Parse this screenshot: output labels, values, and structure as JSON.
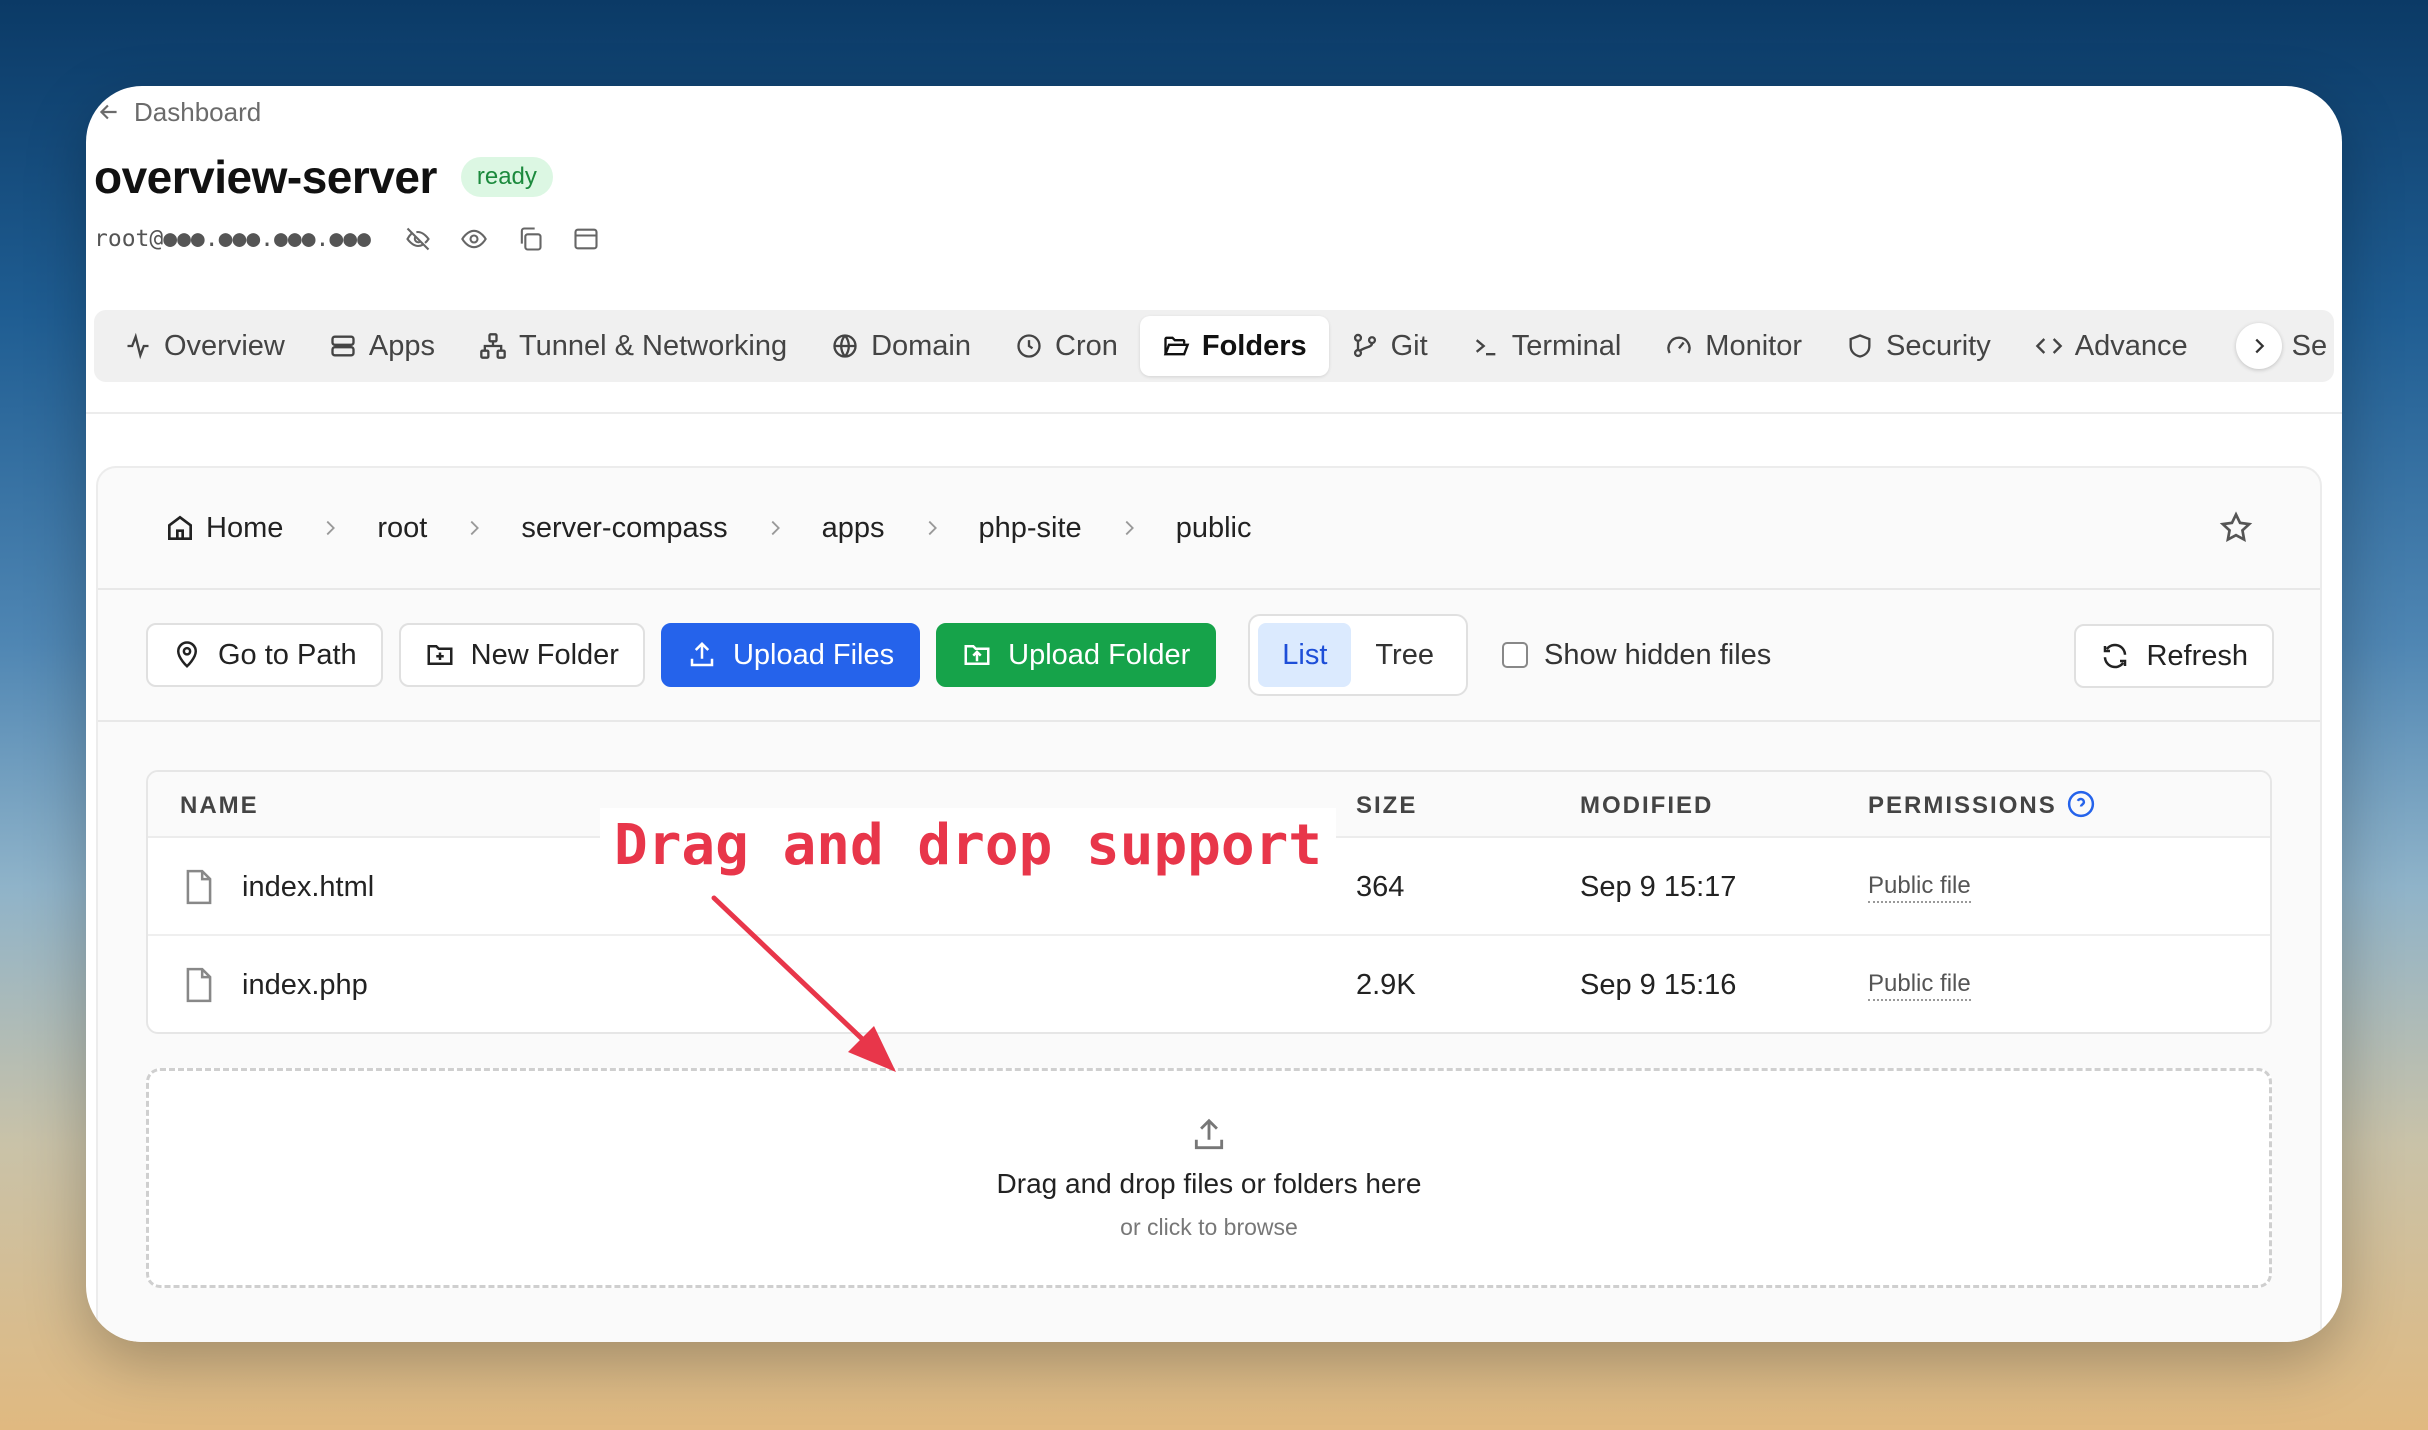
{
  "breadcrumb_back": "Dashboard",
  "server": {
    "name": "overview-server",
    "status": "ready",
    "host": "root@●●●.●●●.●●●.●●●"
  },
  "tabs": [
    {
      "label": "Overview",
      "icon": "activity-icon"
    },
    {
      "label": "Apps",
      "icon": "server-icon"
    },
    {
      "label": "Tunnel & Networking",
      "icon": "network-icon"
    },
    {
      "label": "Domain",
      "icon": "globe-icon"
    },
    {
      "label": "Cron",
      "icon": "clock-icon"
    },
    {
      "label": "Folders",
      "icon": "folder-open-icon",
      "active": true
    },
    {
      "label": "Git",
      "icon": "git-branch-icon"
    },
    {
      "label": "Terminal",
      "icon": "terminal-icon"
    },
    {
      "label": "Monitor",
      "icon": "gauge-icon"
    },
    {
      "label": "Security",
      "icon": "shield-icon"
    },
    {
      "label": "Advance",
      "icon": "code-icon"
    }
  ],
  "tab_overflow_text": "Se",
  "path": [
    "Home",
    "root",
    "server-compass",
    "apps",
    "php-site",
    "public"
  ],
  "toolbar": {
    "go_to_path": "Go to Path",
    "new_folder": "New Folder",
    "upload_files": "Upload Files",
    "upload_folder": "Upload Folder",
    "view_list": "List",
    "view_tree": "Tree",
    "show_hidden": "Show hidden files",
    "refresh": "Refresh"
  },
  "table": {
    "headers": {
      "name": "NAME",
      "size": "SIZE",
      "modified": "MODIFIED",
      "permissions": "PERMISSIONS"
    },
    "rows": [
      {
        "name": "index.html",
        "size": "364",
        "modified": "Sep 9 15:17",
        "permissions": "Public file"
      },
      {
        "name": "index.php",
        "size": "2.9K",
        "modified": "Sep 9 15:16",
        "permissions": "Public file"
      }
    ]
  },
  "dropzone": {
    "title": "Drag and drop files or folders here",
    "subtitle": "or click to browse"
  },
  "annotation": "Drag and drop support",
  "colors": {
    "primary": "#2563eb",
    "success": "#16a34a",
    "annotation": "#e8364a",
    "status_bg": "#dcf7e3"
  }
}
